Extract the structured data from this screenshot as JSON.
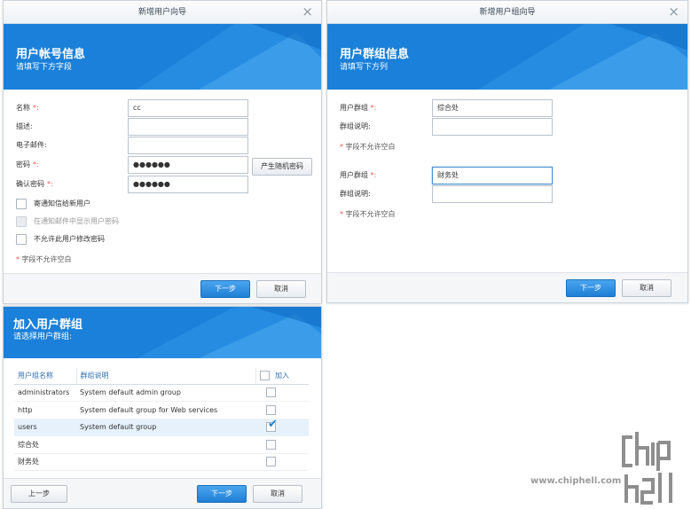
{
  "win1": {
    "title": "新增用户向导",
    "banner_title": "用户帐号信息",
    "banner_subtitle": "请填写下方字段",
    "fields": [
      {
        "label": "名称",
        "required": true,
        "value": "cc"
      },
      {
        "label": "描述:",
        "required": false,
        "value": ""
      },
      {
        "label": "电子邮件:",
        "required": false,
        "value": ""
      },
      {
        "label": "密码",
        "required": true,
        "value": "●●●●●●"
      },
      {
        "label": "确认密码",
        "required": true,
        "value": "●●●●●●"
      }
    ],
    "required_suffix": "*:",
    "random_password_button": "产生随机密码",
    "checkboxes": [
      {
        "label": "寄通知信给新用户",
        "disabled": false
      },
      {
        "label": "在通知邮件中显示用户密码",
        "disabled": true
      },
      {
        "label": "不允许此用户修改密码",
        "disabled": false
      }
    ],
    "required_note": "字段不允许空白",
    "next_button": "下一步",
    "cancel_button": "取消"
  },
  "win2": {
    "title": "新增用户组向导",
    "banner_title": "用户群组信息",
    "banner_subtitle": "请填写下方列",
    "group_label": "用户群组",
    "desc_label": "群组说明:",
    "groups": [
      {
        "name": "综合处",
        "desc": ""
      },
      {
        "name": "财务处",
        "desc": ""
      }
    ],
    "required_note": "字段不允许空白",
    "next_button": "下一步",
    "cancel_button": "取消"
  },
  "win3": {
    "banner_title": "加入用户群组",
    "banner_subtitle": "请选择用户群组:",
    "columns": [
      "用户组名称",
      "群组说明",
      "加入"
    ],
    "rows": [
      {
        "name": "administrators",
        "desc": "System default admin group",
        "checked": false
      },
      {
        "name": "http",
        "desc": "System default group for Web services",
        "checked": false
      },
      {
        "name": "users",
        "desc": "System default group",
        "checked": true
      },
      {
        "name": "综合处",
        "desc": "",
        "checked": false
      },
      {
        "name": "财务处",
        "desc": "",
        "checked": false
      }
    ],
    "prev_button": "上一步",
    "next_button": "下一步",
    "cancel_button": "取消"
  },
  "watermark": {
    "site": "www.chiphell.com",
    "logo_text": "chip hell"
  },
  "colors": {
    "banner_blue": "#1a80d9",
    "primary_button": "#1f7fd6",
    "required_star": "#e55555"
  }
}
